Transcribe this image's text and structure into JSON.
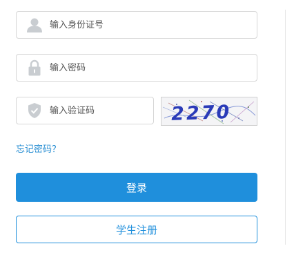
{
  "login_form": {
    "id_field": {
      "placeholder": "输入身份证号",
      "value": "",
      "icon": "user-icon"
    },
    "password_field": {
      "placeholder": "输入密码",
      "value": "",
      "icon": "lock-icon"
    },
    "captcha_field": {
      "placeholder": "输入验证码",
      "value": "",
      "icon": "shield-check-icon"
    },
    "captcha_image": {
      "text": "2270"
    },
    "forgot_password": "忘记密码？",
    "login_button": "登录",
    "register_button": "学生注册"
  },
  "colors": {
    "accent": "#1f8fdc",
    "link": "#2a8fd3",
    "icon": "#c9cdd1",
    "border": "#d6d6d6"
  }
}
